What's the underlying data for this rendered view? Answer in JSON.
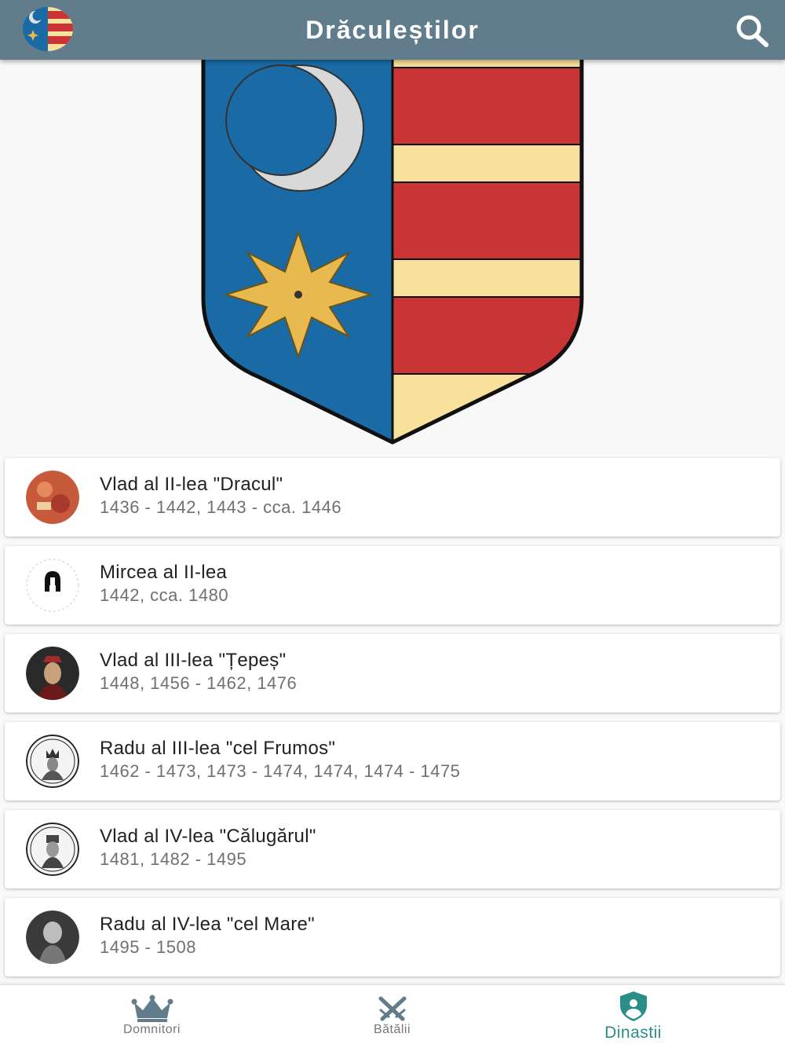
{
  "appbar": {
    "title": "Drăculeștilor",
    "logo_icon": "dynasty-coat-of-arms-icon",
    "search_icon": "search-icon"
  },
  "colors": {
    "appbar": "#617c8a",
    "accent": "#2a8e88",
    "shield_blue": "#1a6aa6",
    "shield_red": "#c93434",
    "shield_gold": "#f7e19b",
    "star": "#e7b94f"
  },
  "rulers": [
    {
      "name": "Vlad al II-lea \"Dracul\"",
      "years": "1436 - 1442, 1443 - cca. 1446",
      "avatar": "portrait-red"
    },
    {
      "name": "Mircea al II-lea",
      "years": "1442, cca. 1480",
      "avatar": "helmet-icon"
    },
    {
      "name": "Vlad al III-lea \"Țepeș\"",
      "years": "1448, 1456 - 1462, 1476",
      "avatar": "portrait-dark"
    },
    {
      "name": "Radu al III-lea \"cel Frumos\"",
      "years": "1462 - 1473, 1473 - 1474, 1474, 1474 - 1475",
      "avatar": "engraving"
    },
    {
      "name": "Vlad al IV-lea \"Călugărul\"",
      "years": "1481, 1482 - 1495",
      "avatar": "engraving"
    },
    {
      "name": "Radu al IV-lea \"cel Mare\"",
      "years": "1495 - 1508",
      "avatar": "portrait-grey"
    }
  ],
  "bottom_nav": [
    {
      "label": "Domnitori",
      "icon": "crown-icon",
      "active": false
    },
    {
      "label": "Bătălii",
      "icon": "crossed-swords-icon",
      "active": false
    },
    {
      "label": "Dinastii",
      "icon": "shield-person-icon",
      "active": true
    }
  ]
}
